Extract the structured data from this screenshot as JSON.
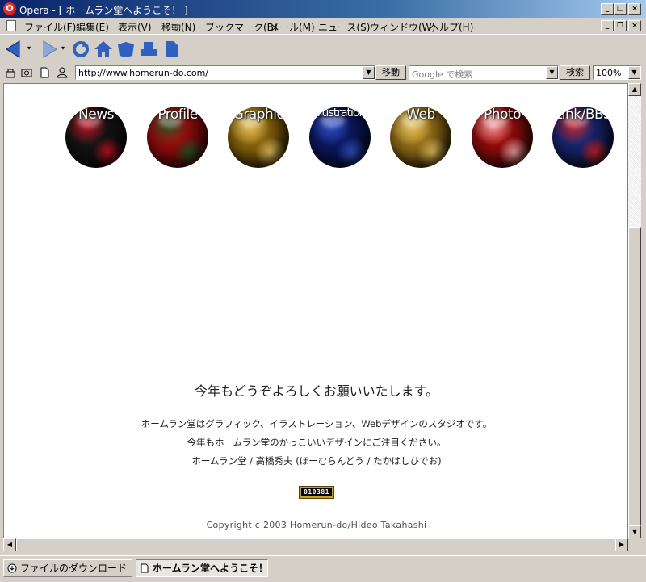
{
  "window": {
    "title": "Opera - [ ホームラン堂へようこそ！ ]",
    "logo_letter": "O",
    "buttons": {
      "minimize": "_",
      "maximize": "□",
      "close": "×"
    }
  },
  "menubar": {
    "items": [
      "ファイル(F)",
      "編集(E)",
      "表示(V)",
      "移動(N)",
      "ブックマーク(B)",
      "メール(M)",
      "ニュース(S)",
      "ウィンドウ(W)",
      "ヘルプ(H)"
    ]
  },
  "toolbar": {
    "icons": [
      "back-icon",
      "forward-icon",
      "reload-icon",
      "home-icon",
      "hotlist-icon",
      "print-icon",
      "document-icon"
    ]
  },
  "addressbar": {
    "url": "http://www.homerun-do.com/",
    "go_label": "移動",
    "search_placeholder": "Google で検索",
    "search_label": "検索",
    "zoom": "100%"
  },
  "page": {
    "nav": [
      {
        "label": "News",
        "color": "#1a1a1a",
        "accent": "#c01020"
      },
      {
        "label": "Profile",
        "color": "#c01010",
        "accent": "#205020"
      },
      {
        "label": "Graphic",
        "color": "#b08010",
        "accent": "#e0c060"
      },
      {
        "label": "Illustration",
        "color": "#102080",
        "accent": "#3050c0"
      },
      {
        "label": "Web",
        "color": "#c09020",
        "accent": "#e0c060"
      },
      {
        "label": "Photo",
        "color": "#c01010",
        "accent": "#f0a0a0"
      },
      {
        "label": "Link/BBS",
        "color": "#203090",
        "accent": "#c02020"
      }
    ],
    "greeting": "今年もどうぞよろしくお願いいたします。",
    "description": [
      "ホームラン堂はグラフィック、イラストレーション、Webデザインのスタジオです。",
      "今年もホームラン堂のかっこいいデザインにご注目ください。",
      "ホームラン堂 / 高橋秀夫 (ほーむらんどう / たかはしひでお)"
    ],
    "counter": "010381",
    "copyright": "Copyright c 2003 Homerun-do/Hideo Takahashi"
  },
  "tabs": [
    {
      "label": "ファイルのダウンロード",
      "active": false
    },
    {
      "label": "ホームラン堂へようこそ！",
      "active": true
    }
  ]
}
